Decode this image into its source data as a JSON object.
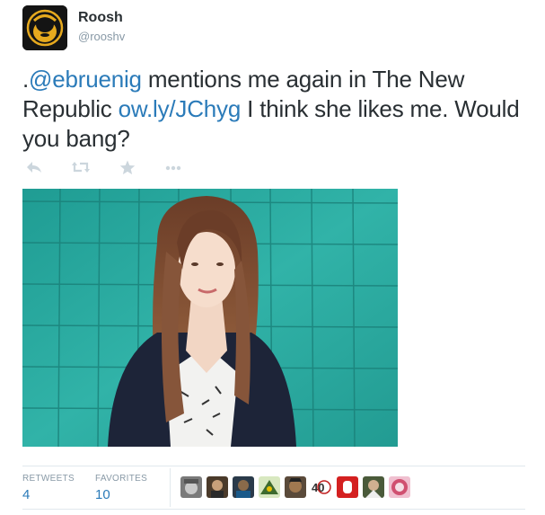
{
  "user": {
    "display_name": "Roosh",
    "screen_name": "@rooshv",
    "avatar_icon": "bearded-face-icon"
  },
  "tweet": {
    "text_prefix": ".",
    "mention": "@ebruenig",
    "text_middle": " mentions me again in The New Republic ",
    "link": "ow.ly/JChyg",
    "text_suffix": " I think she likes me. Would you bang?"
  },
  "actions": [
    {
      "name": "reply-icon"
    },
    {
      "name": "retweet-icon"
    },
    {
      "name": "favorite-icon"
    },
    {
      "name": "more-icon"
    }
  ],
  "photo": {
    "subject": "portrait-photo",
    "background_color": "#2aa59a"
  },
  "stats": {
    "retweets_label": "RETWEETS",
    "retweets_count": "4",
    "favorites_label": "FAVORITES",
    "favorites_count": "10"
  },
  "favoriters": [
    {
      "color": "#6b6b6b",
      "icon": "avatar-1"
    },
    {
      "color": "#4a3a2a",
      "icon": "avatar-2"
    },
    {
      "color": "#2a3a4a",
      "icon": "avatar-3"
    },
    {
      "color": "#3d6b2e",
      "icon": "avatar-4"
    },
    {
      "color": "#5a4a3a",
      "icon": "avatar-5"
    },
    {
      "color": "#ffffff",
      "icon": "avatar-6",
      "text": "40"
    },
    {
      "color": "#d42020",
      "icon": "avatar-7"
    },
    {
      "color": "#4a5a3a",
      "icon": "avatar-8"
    },
    {
      "color": "#d05070",
      "icon": "avatar-9"
    }
  ]
}
